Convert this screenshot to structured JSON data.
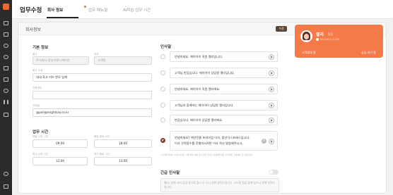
{
  "header": {
    "title": "업무수정",
    "tabs": [
      {
        "label": "회사 정보",
        "active": true
      },
      {
        "label": "업무 매뉴얼",
        "active": false
      },
      {
        "label": "AI학습 업무 시간",
        "active": false
      }
    ]
  },
  "sidebar": {
    "icons": [
      "logo-icon",
      "grid-icon",
      "calendar-icon",
      "settings-icon",
      "user-icon",
      "card-icon",
      "building-icon",
      "phone-icon",
      "chart-icon",
      "bars-icon",
      "pin-icon",
      "door-icon"
    ]
  },
  "card": {
    "title": "회사정보",
    "save_label": "수정"
  },
  "basic": {
    "title": "기본 정보",
    "company_label": "회사",
    "company_value": "주식회사 풍선커뮤니케이션",
    "rank_label": "직급",
    "rank_value": "고객응",
    "intro_label": "회사 소개",
    "intro_value": "내내 화고 리브 한모 업체",
    "contact_label": "전화번호",
    "contact_value": "",
    "email_label": "이메일",
    "email_value": "@poll@mightsay.co.kr"
  },
  "hours": {
    "title": "업무 시간",
    "weekday_start_label": "평일 시작 시간",
    "weekday_start": "09:00",
    "weekday_end_label": "평일 종료 시간",
    "weekday_end": "18:00",
    "lunch_start_label": "휴식 시작 시간",
    "lunch_start": "12:00",
    "lunch_end_label": "휴식 종료 시간",
    "lunch_end": "13:00"
  },
  "greetings": {
    "title": "인사말",
    "items": [
      {
        "text": "안녕하세요. 에이아이 직원 엘리입니다.",
        "selected": false
      },
      {
        "text": "고객님 반갑습니다. 에이아이 상담원 엘리입니다.",
        "selected": false
      },
      {
        "text": "안녕하세요. 에이아이 직원 엘리에요.",
        "selected": false
      },
      {
        "text": "고객님과 함께하는 에이아이 상담원 엘리입니다.",
        "selected": false
      },
      {
        "text": "반갑습니다. 에이아이 상담원 엘리에요.",
        "selected": false
      },
      {
        "line1": "안녕하세요? 백년전통 프리미엄 이사, 풍선익스프레스입니다.",
        "line2": "이사 견적접수를 진행하시려면 이사 하고 말씀해주시고,",
        "selected": true
      }
    ],
    "note": "* 인사말 길이는 10초 이내로, 전화 받는 분이 듣기 좋은 길이로 작성해주세요. 인사말은 고객과의 첫 인상입니다."
  },
  "emergency": {
    "title": "긴급 인사말",
    "toggle_on": false,
    "text": "예시) 현재 서버 점검 중으로 잠시 후 다시 전화 부탁드립니다. 시스템 점검 중에 있으니 양해 부탁드립니다."
  },
  "profile": {
    "name": "엘리",
    "role": "팀장",
    "phone": "02-5321-1234",
    "left_label": "고객응대 중",
    "right_label": "상담 대기 중"
  }
}
